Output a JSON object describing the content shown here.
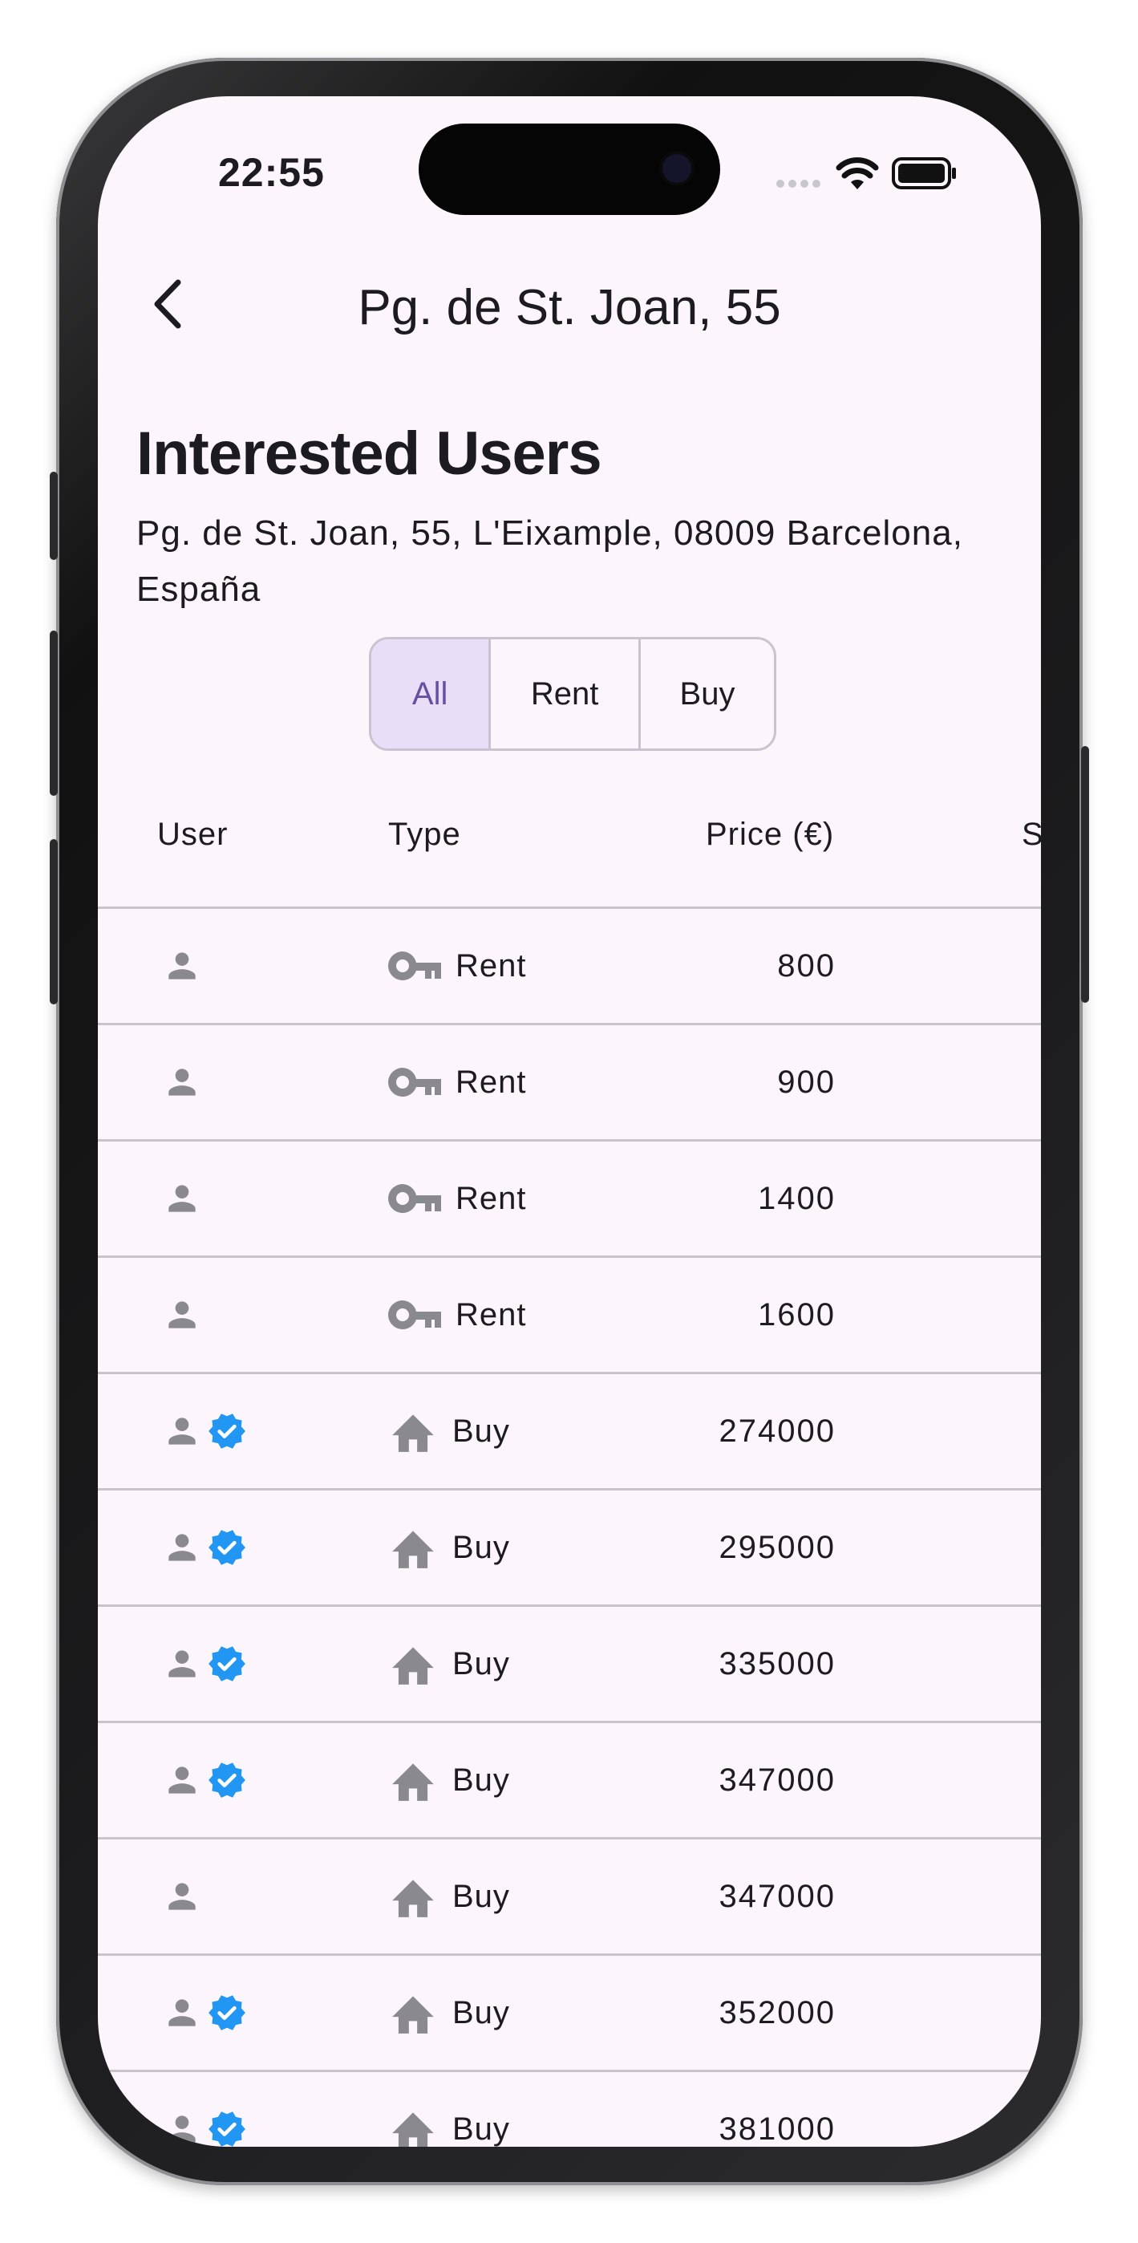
{
  "status_bar": {
    "time": "22:55"
  },
  "nav": {
    "title": "Pg. de St. Joan, 55"
  },
  "page": {
    "heading": "Interested Users",
    "address": "Pg. de St. Joan, 55, L'Eixample, 08009 Barcelona, España"
  },
  "filter": {
    "options": [
      "All",
      "Rent",
      "Buy"
    ],
    "selected": "All"
  },
  "table": {
    "columns": [
      "User",
      "Type",
      "Price (€)",
      "Si"
    ],
    "rows": [
      {
        "verified": false,
        "type": "Rent",
        "type_icon": "key-icon",
        "price": "800"
      },
      {
        "verified": false,
        "type": "Rent",
        "type_icon": "key-icon",
        "price": "900"
      },
      {
        "verified": false,
        "type": "Rent",
        "type_icon": "key-icon",
        "price": "1400"
      },
      {
        "verified": false,
        "type": "Rent",
        "type_icon": "key-icon",
        "price": "1600"
      },
      {
        "verified": true,
        "type": "Buy",
        "type_icon": "house-icon",
        "price": "274000"
      },
      {
        "verified": true,
        "type": "Buy",
        "type_icon": "house-icon",
        "price": "295000"
      },
      {
        "verified": true,
        "type": "Buy",
        "type_icon": "house-icon",
        "price": "335000"
      },
      {
        "verified": true,
        "type": "Buy",
        "type_icon": "house-icon",
        "price": "347000"
      },
      {
        "verified": false,
        "type": "Buy",
        "type_icon": "house-icon",
        "price": "347000"
      },
      {
        "verified": true,
        "type": "Buy",
        "type_icon": "house-icon",
        "price": "352000"
      },
      {
        "verified": true,
        "type": "Buy",
        "type_icon": "house-icon",
        "price": "381000"
      }
    ]
  },
  "colors": {
    "background": "#fcf5fc",
    "text": "#1c1b1f",
    "icon_gray": "#8a8a8e",
    "verified_blue": "#2196f3",
    "segment_selected_bg": "#e8def8",
    "segment_selected_text": "#6750a4",
    "divider": "#c9c4cc"
  }
}
